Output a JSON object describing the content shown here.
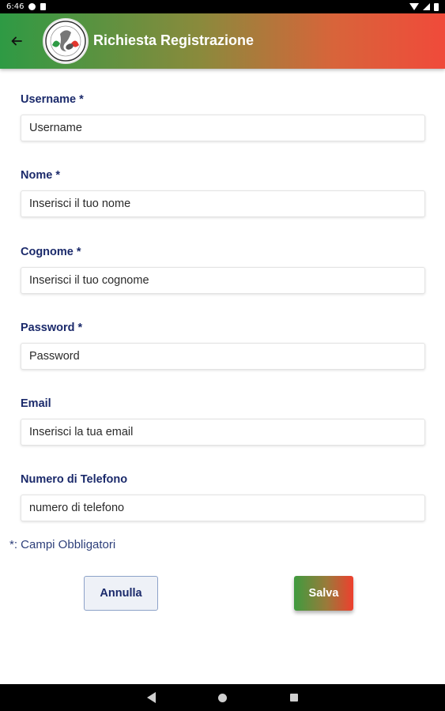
{
  "status_bar": {
    "time": "6:46"
  },
  "app_bar": {
    "title": "Richiesta Registrazione",
    "logo_text": "RUGBY SERPI A.S.D."
  },
  "form": {
    "fields": [
      {
        "label": "Username *",
        "placeholder": "Username"
      },
      {
        "label": "Nome *",
        "placeholder": "Inserisci il tuo nome"
      },
      {
        "label": "Cognome *",
        "placeholder": "Inserisci il tuo cognome"
      },
      {
        "label": "Password *",
        "placeholder": "Password"
      },
      {
        "label": "Email",
        "placeholder": "Inserisci la tua email"
      },
      {
        "label": "Numero di Telefono",
        "placeholder": "numero di telefono"
      }
    ],
    "required_note": "*: Campi Obbligatori"
  },
  "buttons": {
    "cancel_label": "Annulla",
    "save_label": "Salva"
  },
  "colors": {
    "appbar_gradient_start": "#2e9a44",
    "appbar_gradient_end": "#f04a3a",
    "label_color": "#1b2a6b",
    "cancel_bg": "#eef1f7",
    "cancel_border": "#8da2c8"
  },
  "icons": {
    "back": "arrow-left-icon",
    "nav_back": "triangle-back-icon",
    "nav_home": "circle-home-icon",
    "nav_recent": "square-recents-icon"
  }
}
